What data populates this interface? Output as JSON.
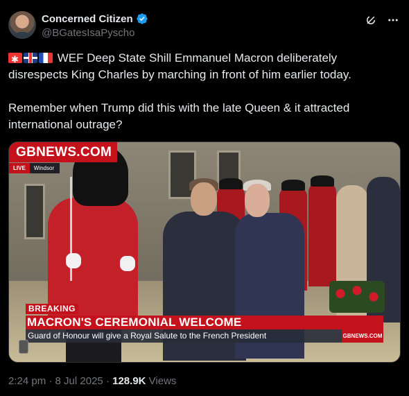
{
  "author": {
    "display_name": "Concerned Citizen",
    "handle": "@BGatesIsaPyscho",
    "avatar_icon": "avatar-photo",
    "verified_icon": "verified-badge-icon",
    "verified_color": "#1d9bf0"
  },
  "header_icons": {
    "grok": "grok-icon",
    "more": "more-options-icon"
  },
  "tweet": {
    "line1": "WEF Deep State Shill Emmanuel Macron deliberately disrespects King Charles by marching in front of him earlier today.",
    "line2": "Remember when Trump did this with the late Queen & it attracted international outrage?",
    "emoji_flags": [
      "pirate-flag-icon",
      "uk-flag-icon",
      "france-flag-icon"
    ]
  },
  "media": {
    "channel_logo": "GBNEWS.COM",
    "live_label": "LIVE",
    "location": "Windsor",
    "breaking_label": "BREAKING",
    "headline": "MACRON'S CEREMONIAL WELCOME",
    "subline": "Guard of Honour will give a Royal Salute to the French President",
    "brand_small": "GBNEWS.COM",
    "accent_color": "#c4121c"
  },
  "meta": {
    "time": "2:24 pm",
    "date": "8 Jul 2025",
    "views_count": "128.9K",
    "views_label": "Views"
  }
}
